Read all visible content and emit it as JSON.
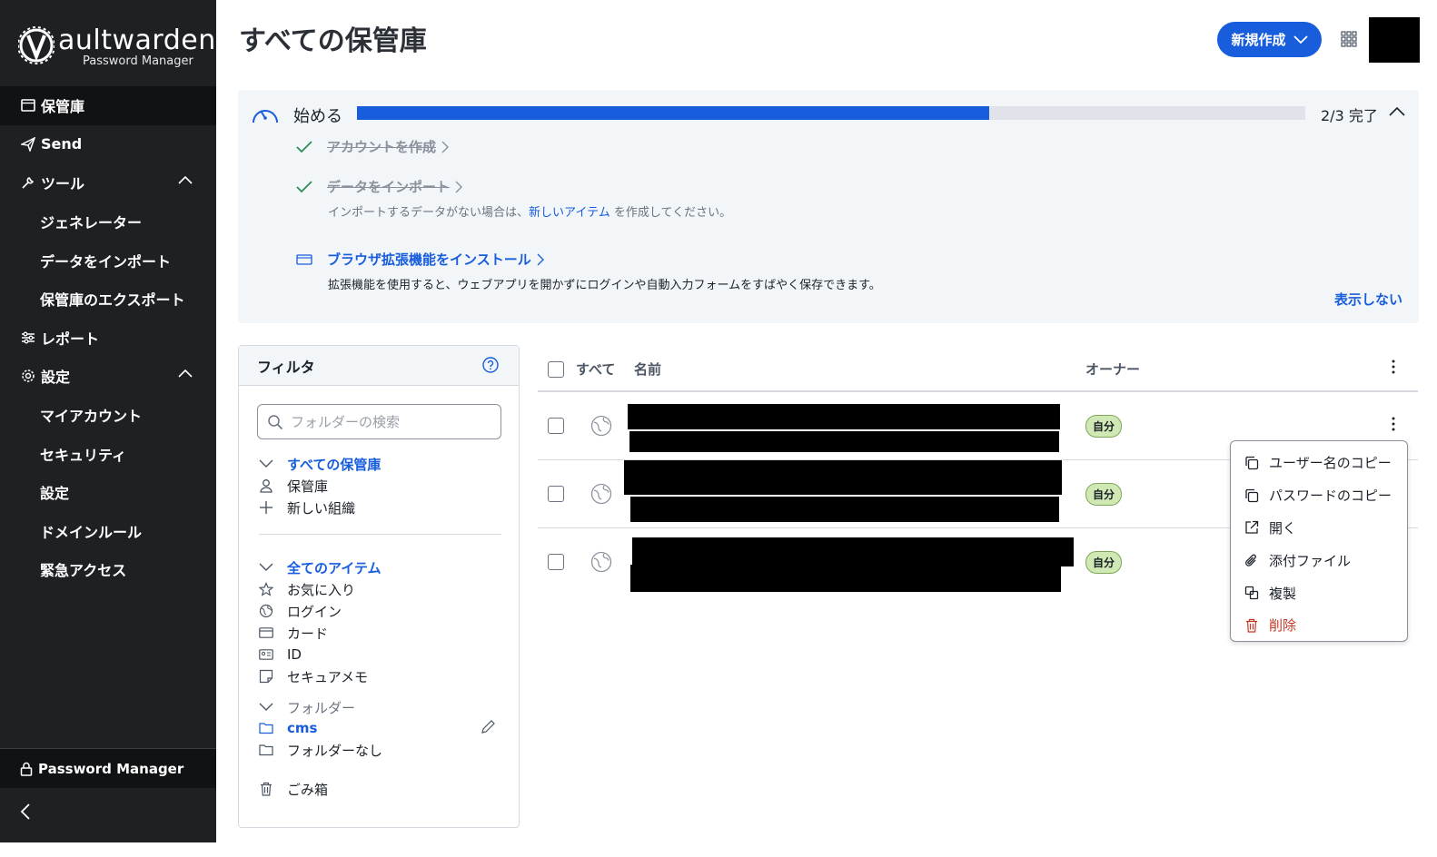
{
  "sidebar": {
    "brand_name": "aultwarden",
    "brand_sub": "Password Manager",
    "items": [
      {
        "label": "保管庫"
      },
      {
        "label": "Send"
      },
      {
        "label": "ツール"
      },
      {
        "label": "ジェネレーター"
      },
      {
        "label": "データをインポート"
      },
      {
        "label": "保管庫のエクスポート"
      },
      {
        "label": "レポート"
      },
      {
        "label": "設定"
      },
      {
        "label": "マイアカウント"
      },
      {
        "label": "セキュリティ"
      },
      {
        "label": "設定"
      },
      {
        "label": "ドメインルール"
      },
      {
        "label": "緊急アクセス"
      }
    ],
    "footer_label": "Password Manager"
  },
  "header": {
    "title": "すべての保管庫",
    "new_button": "新規作成"
  },
  "onboarding": {
    "title": "始める",
    "progress_fraction": 0.667,
    "progress_text": "2/3 完了",
    "tasks": [
      {
        "label": "アカウントを作成",
        "done": true
      },
      {
        "label": "データをインポート",
        "done": true
      },
      {
        "label": "ブラウザ拡張機能をインストール",
        "done": false
      }
    ],
    "import_note_prefix": "インポートするデータがない場合は、",
    "import_note_link": "新しいアイテム",
    "import_note_suffix": " を作成してください。",
    "extension_note": "拡張機能を使用すると、ウェブアプリを開かずにログインや自動入力フォームをすばやく保存できます。",
    "dismiss": "表示しない"
  },
  "filter": {
    "title": "フィルタ",
    "search_placeholder": "フォルダーの検索",
    "vaults_header": "すべての保管庫",
    "vault_items": [
      "保管庫",
      "新しい組織"
    ],
    "types_header": "全てのアイテム",
    "type_items": [
      "お気に入り",
      "ログイン",
      "カード",
      "ID",
      "セキュアメモ"
    ],
    "folders_header": "フォルダー",
    "folder_items": [
      "cms",
      "フォルダーなし"
    ],
    "trash": "ごみ箱"
  },
  "table": {
    "col_all": "すべて",
    "col_name": "名前",
    "col_owner": "オーナー",
    "rows": [
      {
        "owner": "自分"
      },
      {
        "owner": "自分"
      },
      {
        "owner": "自分"
      }
    ]
  },
  "context_menu": {
    "items": [
      {
        "label": "ユーザー名のコピー",
        "icon": "copy-icon"
      },
      {
        "label": "パスワードのコピー",
        "icon": "copy-icon"
      },
      {
        "label": "開く",
        "icon": "external-link-icon"
      },
      {
        "label": "添付ファイル",
        "icon": "paperclip-icon"
      },
      {
        "label": "複製",
        "icon": "clone-icon"
      },
      {
        "label": "削除",
        "icon": "trash-icon"
      }
    ]
  },
  "colors": {
    "primary": "#175ddc",
    "sidebar_bg": "#1e2024",
    "danger": "#c83522",
    "badge_bg": "#cfe8b4"
  }
}
